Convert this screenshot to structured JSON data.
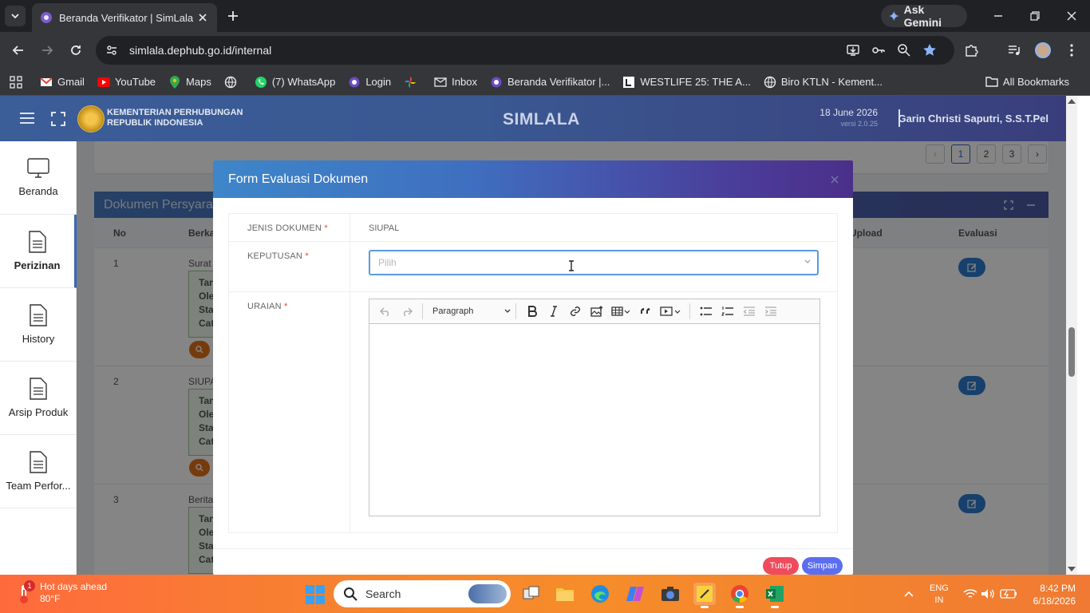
{
  "browser": {
    "tab_title": "Beranda Verifikator | SimLala",
    "gemini_label": "Ask Gemini",
    "url": "simlala.dephub.go.id/internal",
    "bookmarks": [
      {
        "label": "Gmail",
        "icon": "gmail-icon"
      },
      {
        "label": "YouTube",
        "icon": "youtube-icon"
      },
      {
        "label": "Maps",
        "icon": "maps-icon"
      },
      {
        "label": "",
        "icon": "globe-icon"
      },
      {
        "label": "(7) WhatsApp",
        "icon": "whatsapp-icon"
      },
      {
        "label": "Login",
        "icon": "globe-icon"
      },
      {
        "label": "",
        "icon": "pinwheel-icon"
      },
      {
        "label": "Inbox",
        "icon": "mail-icon"
      },
      {
        "label": "Beranda Verifikator |...",
        "icon": "globe-icon"
      },
      {
        "label": "WESTLIFE 25: THE A...",
        "icon": "letter-l-icon"
      },
      {
        "label": "Biro KTLN - Kement...",
        "icon": "globe-icon"
      }
    ],
    "all_bookmarks": "All Bookmarks"
  },
  "header": {
    "ministry_line1": "KEMENTERIAN PERHUBUNGAN",
    "ministry_line2": "REPUBLIK INDONESIA",
    "brand": "SIMLALA",
    "date": "18 June 2026",
    "version": "versi 2.0.25",
    "user": "Garin Christi Saputri, S.S.T.Pel"
  },
  "sidebar": {
    "items": [
      {
        "label": "Beranda"
      },
      {
        "label": "Perizinan"
      },
      {
        "label": "History"
      },
      {
        "label": "Arsip Produk"
      },
      {
        "label": "Team Perfor..."
      }
    ]
  },
  "pagination": {
    "pages": [
      "1",
      "2",
      "3"
    ],
    "current": "1"
  },
  "doc_card": {
    "title": "Dokumen Persyarat",
    "columns": {
      "no": "No",
      "berkas": "Berka",
      "upload": "Upload",
      "evaluasi": "Evaluasi"
    },
    "rows": [
      {
        "no": "1",
        "doc": "Surat P",
        "lines": [
          "Tan",
          "Ole",
          "Stat",
          "Cat"
        ]
      },
      {
        "no": "2",
        "doc": "SIUPAL",
        "lines": [
          "Tan",
          "Ole",
          "Stat",
          "Cat"
        ]
      },
      {
        "no": "3",
        "doc": "Berita",
        "lines": [
          "Tan",
          "Ole",
          "Stat",
          "Cat"
        ]
      }
    ]
  },
  "modal": {
    "title": "Form Evaluasi Dokumen",
    "jenis_label": "JENIS DOKUMEN",
    "jenis_value": "SIUPAL",
    "keputusan_label": "KEPUTUSAN",
    "keputusan_placeholder": "Pilih",
    "uraian_label": "URAIAN",
    "required_mark": "*",
    "editor_block_format": "Paragraph",
    "btn_tutup": "Tutup",
    "btn_simpan": "Simpan"
  },
  "taskbar": {
    "weather_title": "Hot days ahead",
    "weather_temp": "80°F",
    "weather_badge": "1",
    "search_label": "Search",
    "lang_line1": "ENG",
    "lang_line2": "IN",
    "time": "8:42 PM",
    "date": "6/18/2026"
  },
  "colors": {
    "header_blue": "#3b5d98",
    "modal_gradient_start": "#3e86c9",
    "modal_gradient_end": "#4b2f8a",
    "select_focus": "#5a9be0",
    "btn_tutup": "#ef4b5c",
    "btn_simpan": "#5c6ef0",
    "taskbar_orange": "#f5862e"
  }
}
